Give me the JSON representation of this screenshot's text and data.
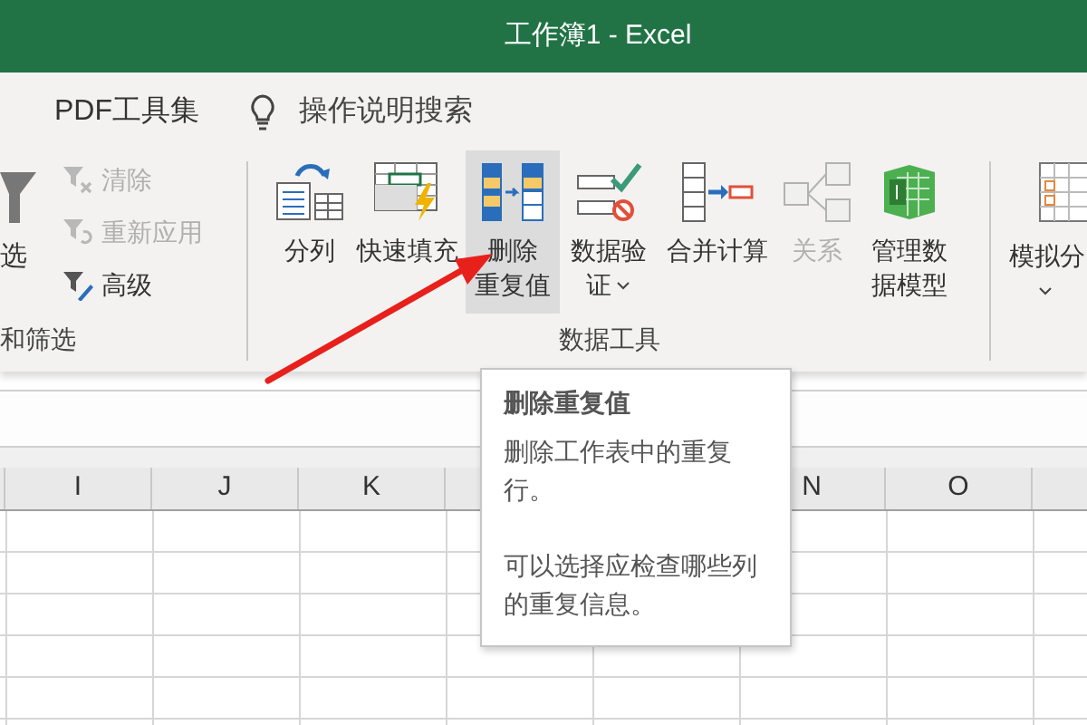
{
  "title_bar": {
    "title": "工作簿1 - Excel"
  },
  "menu": {
    "items": [
      {
        "label": "PDF工具集"
      }
    ],
    "search": {
      "label": "操作说明搜索"
    }
  },
  "filter_group": {
    "label": "和筛选",
    "large_button": {
      "label": "选"
    },
    "small_buttons": [
      {
        "kind": "clear",
        "label": "清除",
        "disabled": true
      },
      {
        "kind": "reapply",
        "label": "重新应用",
        "disabled": true
      },
      {
        "kind": "advanced",
        "label": "高级",
        "disabled": false
      }
    ]
  },
  "data_tools_group": {
    "label": "数据工具",
    "buttons": [
      {
        "kind": "split",
        "lines": [
          "分列"
        ],
        "selected": false,
        "disabled": false
      },
      {
        "kind": "flash",
        "lines": [
          "快速填充"
        ],
        "selected": false,
        "disabled": false
      },
      {
        "kind": "dedupe",
        "lines": [
          "删除",
          "重复值"
        ],
        "selected": true,
        "disabled": false
      },
      {
        "kind": "validate",
        "lines": [
          "数据验",
          "证"
        ],
        "selected": false,
        "disabled": false,
        "dropdown": true
      },
      {
        "kind": "consolidate",
        "lines": [
          "合并计算"
        ],
        "selected": false,
        "disabled": false
      },
      {
        "kind": "relations",
        "lines": [
          "关系"
        ],
        "selected": false,
        "disabled": true
      },
      {
        "kind": "model",
        "lines": [
          "管理数",
          "据模型"
        ],
        "selected": false,
        "disabled": false
      }
    ]
  },
  "forecast_group": {
    "button": {
      "label": "模拟分",
      "dropdown": true
    }
  },
  "sheet": {
    "columns": [
      {
        "label": "I"
      },
      {
        "label": "J"
      },
      {
        "label": "K"
      },
      {
        "label": "N"
      },
      {
        "label": "O"
      }
    ]
  },
  "tooltip": {
    "title": "删除重复值",
    "paragraphs": [
      "删除工作表中的重复行。",
      "可以选择应检查哪些列的重复信息。"
    ]
  }
}
